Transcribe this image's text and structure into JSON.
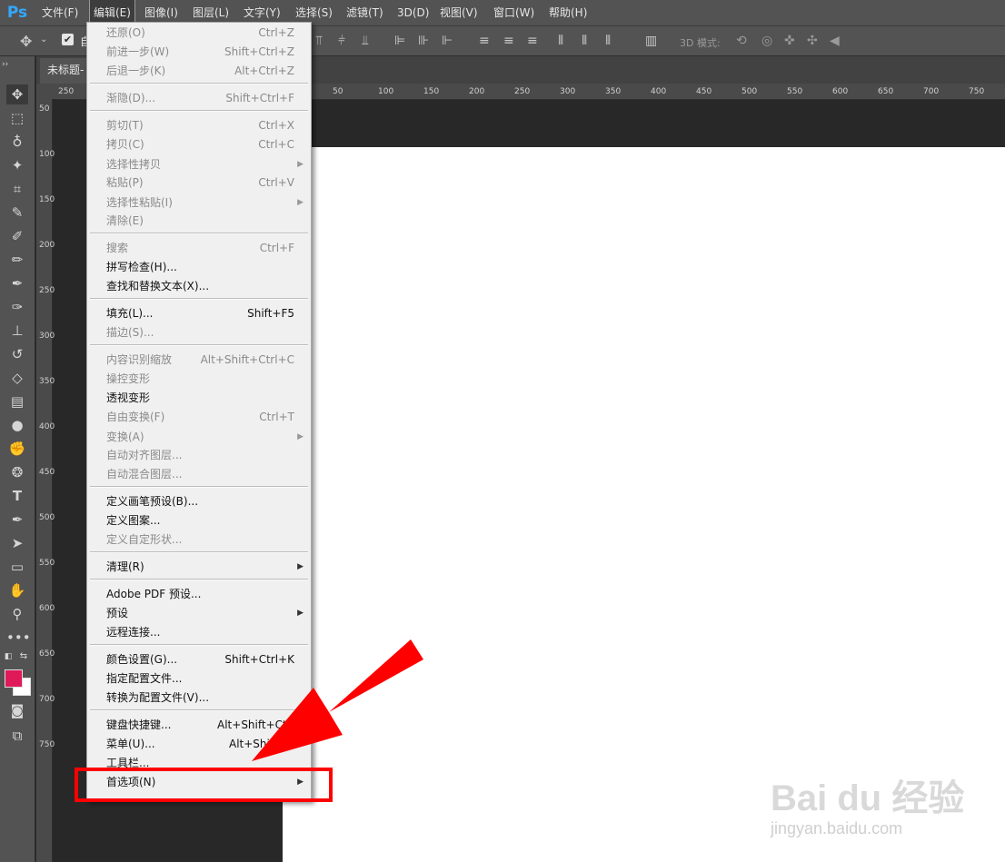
{
  "app": {
    "logo": "Ps"
  },
  "menubar": {
    "items": [
      "文件(F)",
      "编辑(E)",
      "图像(I)",
      "图层(L)",
      "文字(Y)",
      "选择(S)",
      "滤镜(T)",
      "3D(D)",
      "视图(V)",
      "窗口(W)",
      "帮助(H)"
    ],
    "active_index": 1
  },
  "options_bar": {
    "mode_label": "3D 模式:",
    "auto_select_label": "自"
  },
  "document": {
    "tab_title": "未标题-"
  },
  "rulers": {
    "h_labels": [
      "250",
      "50",
      "100",
      "150",
      "200",
      "250",
      "300",
      "350",
      "400",
      "450",
      "500",
      "550",
      "600",
      "650",
      "700",
      "750"
    ],
    "v_labels": [
      "50",
      "100",
      "150",
      "200",
      "250",
      "300",
      "350",
      "400",
      "450",
      "500",
      "550",
      "600",
      "650",
      "700",
      "750"
    ]
  },
  "edit_menu": {
    "items": [
      {
        "label": "还原(O)",
        "shortcut": "Ctrl+Z",
        "enabled": false,
        "submenu": false
      },
      {
        "label": "前进一步(W)",
        "shortcut": "Shift+Ctrl+Z",
        "enabled": false,
        "submenu": false
      },
      {
        "label": "后退一步(K)",
        "shortcut": "Alt+Ctrl+Z",
        "enabled": false,
        "submenu": false
      },
      {
        "label": "渐隐(D)...",
        "shortcut": "Shift+Ctrl+F",
        "enabled": false,
        "submenu": false
      },
      {
        "label": "剪切(T)",
        "shortcut": "Ctrl+X",
        "enabled": false,
        "submenu": false
      },
      {
        "label": "拷贝(C)",
        "shortcut": "Ctrl+C",
        "enabled": false,
        "submenu": false
      },
      {
        "label": "选择性拷贝",
        "shortcut": "",
        "enabled": false,
        "submenu": true
      },
      {
        "label": "粘贴(P)",
        "shortcut": "Ctrl+V",
        "enabled": false,
        "submenu": false
      },
      {
        "label": "选择性粘贴(I)",
        "shortcut": "",
        "enabled": false,
        "submenu": true
      },
      {
        "label": "清除(E)",
        "shortcut": "",
        "enabled": false,
        "submenu": false
      },
      {
        "label": "搜索",
        "shortcut": "Ctrl+F",
        "enabled": false,
        "submenu": false
      },
      {
        "label": "拼写检查(H)...",
        "shortcut": "",
        "enabled": true,
        "submenu": false
      },
      {
        "label": "查找和替换文本(X)...",
        "shortcut": "",
        "enabled": true,
        "submenu": false
      },
      {
        "label": "填充(L)...",
        "shortcut": "Shift+F5",
        "enabled": true,
        "submenu": false
      },
      {
        "label": "描边(S)...",
        "shortcut": "",
        "enabled": false,
        "submenu": false
      },
      {
        "label": "内容识别缩放",
        "shortcut": "Alt+Shift+Ctrl+C",
        "enabled": false,
        "submenu": false
      },
      {
        "label": "操控变形",
        "shortcut": "",
        "enabled": false,
        "submenu": false
      },
      {
        "label": "透视变形",
        "shortcut": "",
        "enabled": true,
        "submenu": false
      },
      {
        "label": "自由变换(F)",
        "shortcut": "Ctrl+T",
        "enabled": false,
        "submenu": false
      },
      {
        "label": "变换(A)",
        "shortcut": "",
        "enabled": false,
        "submenu": true
      },
      {
        "label": "自动对齐图层...",
        "shortcut": "",
        "enabled": false,
        "submenu": false
      },
      {
        "label": "自动混合图层...",
        "shortcut": "",
        "enabled": false,
        "submenu": false
      },
      {
        "label": "定义画笔预设(B)...",
        "shortcut": "",
        "enabled": true,
        "submenu": false
      },
      {
        "label": "定义图案...",
        "shortcut": "",
        "enabled": true,
        "submenu": false
      },
      {
        "label": "定义自定形状...",
        "shortcut": "",
        "enabled": false,
        "submenu": false
      },
      {
        "label": "清理(R)",
        "shortcut": "",
        "enabled": true,
        "submenu": true
      },
      {
        "label": "Adobe PDF 预设...",
        "shortcut": "",
        "enabled": true,
        "submenu": false
      },
      {
        "label": "预设",
        "shortcut": "",
        "enabled": true,
        "submenu": true
      },
      {
        "label": "远程连接...",
        "shortcut": "",
        "enabled": true,
        "submenu": false
      },
      {
        "label": "颜色设置(G)...",
        "shortcut": "Shift+Ctrl+K",
        "enabled": true,
        "submenu": false
      },
      {
        "label": "指定配置文件...",
        "shortcut": "",
        "enabled": true,
        "submenu": false
      },
      {
        "label": "转换为配置文件(V)...",
        "shortcut": "",
        "enabled": true,
        "submenu": false
      },
      {
        "label": "键盘快捷键...",
        "shortcut": "Alt+Shift+Ctrl",
        "enabled": true,
        "submenu": false
      },
      {
        "label": "菜单(U)...",
        "shortcut": "Alt+Shift+C",
        "enabled": true,
        "submenu": false
      },
      {
        "label": "工具栏...",
        "shortcut": "",
        "enabled": true,
        "submenu": false
      },
      {
        "label": "首选项(N)",
        "shortcut": "",
        "enabled": true,
        "submenu": true
      }
    ]
  },
  "colors": {
    "foreground": "#e0195a",
    "background": "#ffffff",
    "highlight": "#ff0000"
  },
  "watermark": {
    "brand": "Bai du 经验",
    "url": "jingyan.baidu.com"
  }
}
